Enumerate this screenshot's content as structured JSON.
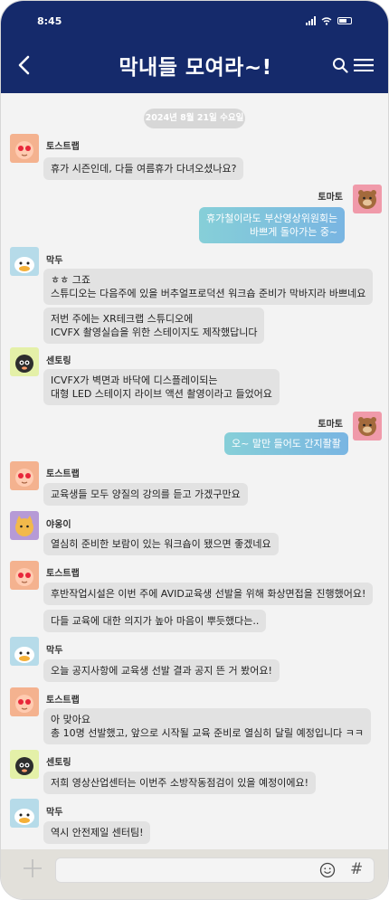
{
  "status": {
    "time": "8:45"
  },
  "header": {
    "title": "막내들 모여라~!"
  },
  "date_chip": "2024년 8월 21일 수요일",
  "messages": [
    {
      "sender": "토스트랩",
      "lines": [
        "휴가 시즌인데, 다들 여름휴가 다녀오셨나요?"
      ]
    },
    {
      "sender": "토마토",
      "lines": [
        "휴가철이라도 부산영상위원회는",
        "바쁘게 돌아가는 중~"
      ]
    },
    {
      "sender": "막두",
      "lines": [
        "ㅎㅎ 그죠",
        "스튜디오는 다음주에 있을 버추얼프로덕션 워크숍 준비가 막바지라 바쁘네요"
      ]
    },
    {
      "sender": "막두",
      "lines": [
        "저번 주에는 XR테크랩 스튜디오에",
        "ICVFX 촬영실습을 위한 스테이지도 제작했답니다"
      ]
    },
    {
      "sender": "센토링",
      "lines": [
        "ICVFX가 벽면과 바닥에 디스플레이되는",
        "대형 LED 스테이지 라이브 액션 촬영이라고 들었어요"
      ]
    },
    {
      "sender": "토마토",
      "lines": [
        "오~ 말만 들어도 간지좔좔"
      ]
    },
    {
      "sender": "토스트랩",
      "lines": [
        "교육생들 모두 양질의 강의를 듣고 가겠구만요"
      ]
    },
    {
      "sender": "야옹이",
      "lines": [
        "열심히 준비한 보람이 있는 워크숍이 됐으면 좋겠네요"
      ]
    },
    {
      "sender": "토스트랩",
      "lines": [
        "후반작업시설은 이번 주에 AVID교육생 선발을 위해 화상면접을 진행했어요!"
      ]
    },
    {
      "sender": "토스트랩",
      "lines": [
        "다들 교육에 대한 의지가 높아 마음이 뿌듯했다는.."
      ]
    },
    {
      "sender": "막두",
      "lines": [
        "오늘 공지사항에 교육생 선발 결과 공지 뜬 거 봤어요!"
      ]
    },
    {
      "sender": "토스트랩",
      "lines": [
        "아 맞아요",
        "총 10명 선발했고, 앞으로 시작될 교육 준비로 열심히 달릴 예정입니다 ㅋㅋ"
      ]
    },
    {
      "sender": "센토링",
      "lines": [
        "저희 영상산업센터는 이번주 소방작동점검이 있을 예정이에요!"
      ]
    },
    {
      "sender": "막두",
      "lines": [
        "역시 안전제일 센터팀!"
      ]
    }
  ],
  "input": {
    "placeholder": ""
  },
  "colors": {
    "header": "#152a6b",
    "mine_start": "#86cfd8",
    "mine_end": "#79b5e2",
    "bubble": "#e2e2e2"
  }
}
